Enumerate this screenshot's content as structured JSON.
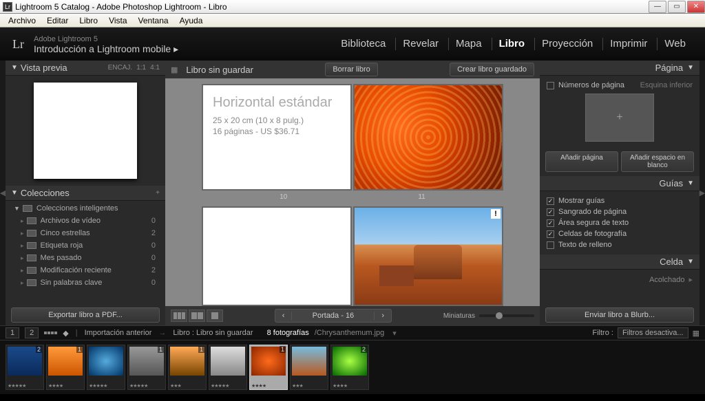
{
  "window": {
    "title": "Lightroom 5 Catalog - Adobe Photoshop Lightroom - Libro"
  },
  "menu": [
    "Archivo",
    "Editar",
    "Libro",
    "Vista",
    "Ventana",
    "Ayuda"
  ],
  "header": {
    "product": "Adobe Lightroom 5",
    "tagline": "Introducción a Lightroom mobile  ▸",
    "modules": [
      "Biblioteca",
      "Revelar",
      "Mapa",
      "Libro",
      "Proyección",
      "Imprimir",
      "Web"
    ],
    "active_module": "Libro"
  },
  "left": {
    "preview": {
      "title": "Vista previa",
      "badges": [
        "ENCAJ.",
        "1:1",
        "4:1"
      ]
    },
    "collections": {
      "title": "Colecciones",
      "plus": "+",
      "items": [
        {
          "name": "Colecciones inteligentes",
          "count": ""
        },
        {
          "name": "Archivos de vídeo",
          "count": "0"
        },
        {
          "name": "Cinco estrellas",
          "count": "2"
        },
        {
          "name": "Etiqueta roja",
          "count": "0"
        },
        {
          "name": "Mes pasado",
          "count": "0"
        },
        {
          "name": "Modificación reciente",
          "count": "2"
        },
        {
          "name": "Sin palabras clave",
          "count": "0"
        }
      ]
    },
    "export_btn": "Exportar libro a PDF..."
  },
  "center": {
    "topbar": {
      "title": "Libro sin guardar",
      "btn_delete": "Borrar libro",
      "btn_save": "Crear libro guardado"
    },
    "book_info": {
      "title": "Horizontal estándar",
      "line1": "25 x 20 cm (10 x 8 pulg.)",
      "line2": "16 páginas - US $36.71"
    },
    "page_left": "10",
    "page_right": "11",
    "bottom": {
      "nav_prev": "‹",
      "nav_label": "Portada - 16",
      "nav_next": "›",
      "thumbs_label": "Miniaturas"
    }
  },
  "right": {
    "page": {
      "title": "Página",
      "pagenum_label": "Números de página",
      "corner": "Esquina inferior",
      "btn_add": "Añadir página",
      "btn_blank": "Añadir espacio en blanco"
    },
    "guides": {
      "title": "Guías",
      "show": "Mostrar guías",
      "items": [
        {
          "label": "Sangrado de página",
          "on": true
        },
        {
          "label": "Área segura de texto",
          "on": true
        },
        {
          "label": "Celdas de fotografía",
          "on": true
        },
        {
          "label": "Texto de relleno",
          "on": false
        }
      ]
    },
    "cell": {
      "title": "Celda",
      "pad": "Acolchado"
    },
    "send_btn": "Enviar libro a Blurb..."
  },
  "sectool": {
    "pages": [
      "1",
      "2"
    ],
    "breadcrumb1": "Importación anterior",
    "breadcrumb2": "Libro : Libro sin guardar",
    "count": "8 fotografías",
    "filename": "/Chrysanthemum.jpg",
    "filter_label": "Filtro :",
    "filter_sel": "Filtros desactiva..."
  },
  "filmstrip": [
    {
      "badge": "2",
      "stars": "★★★★★",
      "bg": "linear-gradient(#1a4a8a,#0a2a5a)"
    },
    {
      "badge": "1",
      "stars": "★★★★",
      "bg": "linear-gradient(#ff9a3a,#cc5500)"
    },
    {
      "badge": "",
      "stars": "★★★★★",
      "bg": "radial-gradient(#5ad,#036)"
    },
    {
      "badge": "1",
      "stars": "★★★★★",
      "bg": "linear-gradient(#999,#555)"
    },
    {
      "badge": "1",
      "stars": "★★★",
      "bg": "linear-gradient(#fa5,#740)"
    },
    {
      "badge": "",
      "stars": "★★★★★",
      "bg": "linear-gradient(#ddd,#888)"
    },
    {
      "badge": "1",
      "stars": "★★★★",
      "bg": "radial-gradient(#ff6b1a,#8a2500)",
      "sel": true
    },
    {
      "badge": "",
      "stars": "★★★",
      "bg": "linear-gradient(#7bd,#b85820)"
    },
    {
      "badge": "2",
      "stars": "★★★★",
      "bg": "radial-gradient(#af4,#060)"
    }
  ]
}
